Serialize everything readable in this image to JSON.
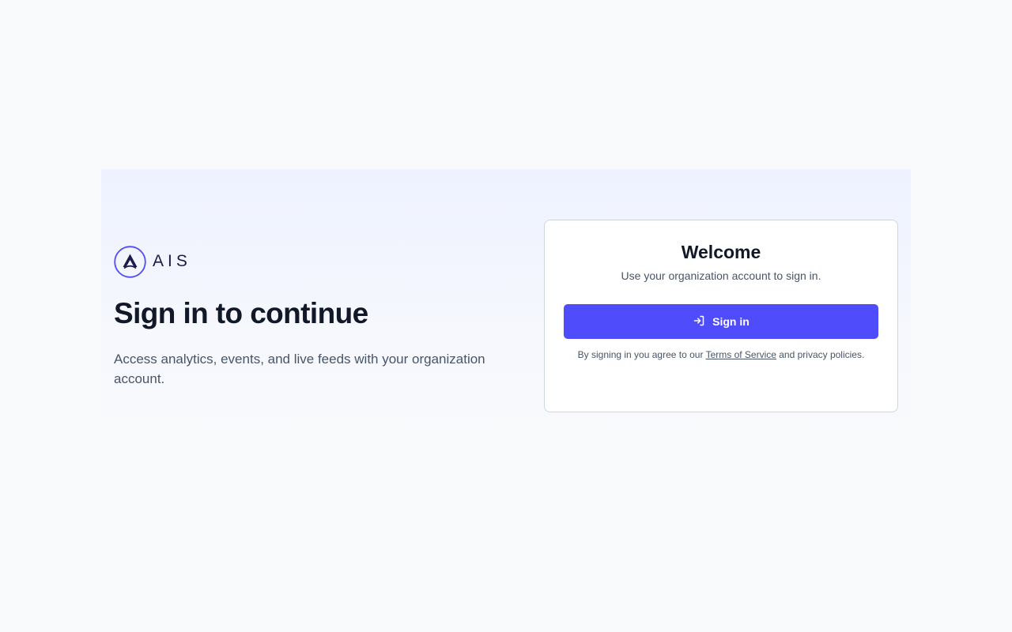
{
  "brand": {
    "name": "AIS",
    "logo_icon": "ais-logo-icon"
  },
  "intro": {
    "title": "Sign in to continue",
    "description": "Access analytics, events, and live feeds with your organization account."
  },
  "card": {
    "title": "Welcome",
    "subtitle": "Use your organization account to sign in.",
    "signin_label": "Sign in",
    "signin_icon": "sign-in-icon",
    "legal_prefix": "By signing in you agree to our ",
    "terms_link": "Terms of Service",
    "legal_suffix": " and privacy policies."
  },
  "colors": {
    "accent": "#4f4cfb",
    "background": "#f8fafc",
    "heading": "#111827",
    "muted": "#475569"
  }
}
